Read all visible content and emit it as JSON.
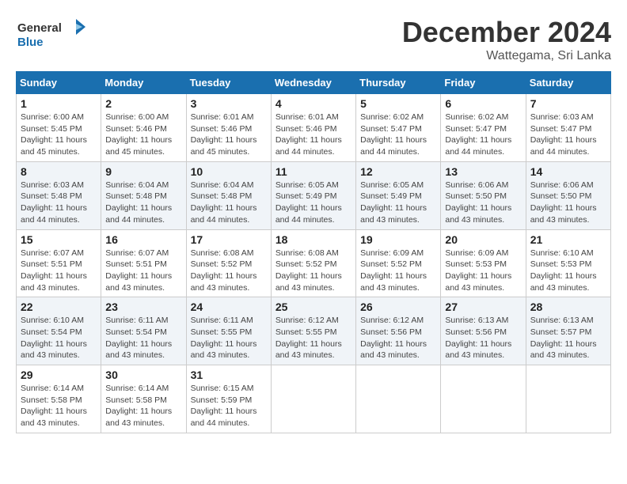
{
  "header": {
    "logo_line1": "General",
    "logo_line2": "Blue",
    "month": "December 2024",
    "location": "Wattegama, Sri Lanka"
  },
  "columns": [
    "Sunday",
    "Monday",
    "Tuesday",
    "Wednesday",
    "Thursday",
    "Friday",
    "Saturday"
  ],
  "weeks": [
    [
      {
        "day": 1,
        "sunrise": "6:00 AM",
        "sunset": "5:45 PM",
        "daylight": "11 hours and 45 minutes."
      },
      {
        "day": 2,
        "sunrise": "6:00 AM",
        "sunset": "5:46 PM",
        "daylight": "11 hours and 45 minutes."
      },
      {
        "day": 3,
        "sunrise": "6:01 AM",
        "sunset": "5:46 PM",
        "daylight": "11 hours and 45 minutes."
      },
      {
        "day": 4,
        "sunrise": "6:01 AM",
        "sunset": "5:46 PM",
        "daylight": "11 hours and 44 minutes."
      },
      {
        "day": 5,
        "sunrise": "6:02 AM",
        "sunset": "5:47 PM",
        "daylight": "11 hours and 44 minutes."
      },
      {
        "day": 6,
        "sunrise": "6:02 AM",
        "sunset": "5:47 PM",
        "daylight": "11 hours and 44 minutes."
      },
      {
        "day": 7,
        "sunrise": "6:03 AM",
        "sunset": "5:47 PM",
        "daylight": "11 hours and 44 minutes."
      }
    ],
    [
      {
        "day": 8,
        "sunrise": "6:03 AM",
        "sunset": "5:48 PM",
        "daylight": "11 hours and 44 minutes."
      },
      {
        "day": 9,
        "sunrise": "6:04 AM",
        "sunset": "5:48 PM",
        "daylight": "11 hours and 44 minutes."
      },
      {
        "day": 10,
        "sunrise": "6:04 AM",
        "sunset": "5:48 PM",
        "daylight": "11 hours and 44 minutes."
      },
      {
        "day": 11,
        "sunrise": "6:05 AM",
        "sunset": "5:49 PM",
        "daylight": "11 hours and 44 minutes."
      },
      {
        "day": 12,
        "sunrise": "6:05 AM",
        "sunset": "5:49 PM",
        "daylight": "11 hours and 43 minutes."
      },
      {
        "day": 13,
        "sunrise": "6:06 AM",
        "sunset": "5:50 PM",
        "daylight": "11 hours and 43 minutes."
      },
      {
        "day": 14,
        "sunrise": "6:06 AM",
        "sunset": "5:50 PM",
        "daylight": "11 hours and 43 minutes."
      }
    ],
    [
      {
        "day": 15,
        "sunrise": "6:07 AM",
        "sunset": "5:51 PM",
        "daylight": "11 hours and 43 minutes."
      },
      {
        "day": 16,
        "sunrise": "6:07 AM",
        "sunset": "5:51 PM",
        "daylight": "11 hours and 43 minutes."
      },
      {
        "day": 17,
        "sunrise": "6:08 AM",
        "sunset": "5:52 PM",
        "daylight": "11 hours and 43 minutes."
      },
      {
        "day": 18,
        "sunrise": "6:08 AM",
        "sunset": "5:52 PM",
        "daylight": "11 hours and 43 minutes."
      },
      {
        "day": 19,
        "sunrise": "6:09 AM",
        "sunset": "5:52 PM",
        "daylight": "11 hours and 43 minutes."
      },
      {
        "day": 20,
        "sunrise": "6:09 AM",
        "sunset": "5:53 PM",
        "daylight": "11 hours and 43 minutes."
      },
      {
        "day": 21,
        "sunrise": "6:10 AM",
        "sunset": "5:53 PM",
        "daylight": "11 hours and 43 minutes."
      }
    ],
    [
      {
        "day": 22,
        "sunrise": "6:10 AM",
        "sunset": "5:54 PM",
        "daylight": "11 hours and 43 minutes."
      },
      {
        "day": 23,
        "sunrise": "6:11 AM",
        "sunset": "5:54 PM",
        "daylight": "11 hours and 43 minutes."
      },
      {
        "day": 24,
        "sunrise": "6:11 AM",
        "sunset": "5:55 PM",
        "daylight": "11 hours and 43 minutes."
      },
      {
        "day": 25,
        "sunrise": "6:12 AM",
        "sunset": "5:55 PM",
        "daylight": "11 hours and 43 minutes."
      },
      {
        "day": 26,
        "sunrise": "6:12 AM",
        "sunset": "5:56 PM",
        "daylight": "11 hours and 43 minutes."
      },
      {
        "day": 27,
        "sunrise": "6:13 AM",
        "sunset": "5:56 PM",
        "daylight": "11 hours and 43 minutes."
      },
      {
        "day": 28,
        "sunrise": "6:13 AM",
        "sunset": "5:57 PM",
        "daylight": "11 hours and 43 minutes."
      }
    ],
    [
      {
        "day": 29,
        "sunrise": "6:14 AM",
        "sunset": "5:58 PM",
        "daylight": "11 hours and 43 minutes."
      },
      {
        "day": 30,
        "sunrise": "6:14 AM",
        "sunset": "5:58 PM",
        "daylight": "11 hours and 43 minutes."
      },
      {
        "day": 31,
        "sunrise": "6:15 AM",
        "sunset": "5:59 PM",
        "daylight": "11 hours and 44 minutes."
      },
      null,
      null,
      null,
      null
    ]
  ]
}
